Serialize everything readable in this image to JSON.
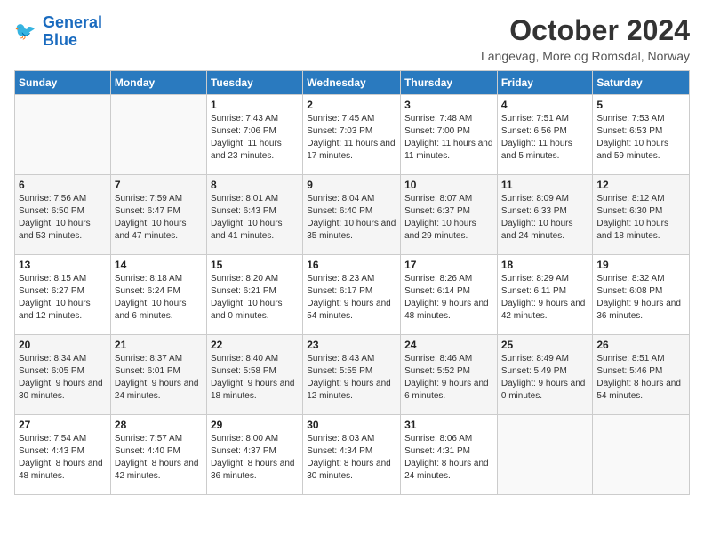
{
  "header": {
    "logo_line1": "General",
    "logo_line2": "Blue",
    "month_title": "October 2024",
    "location": "Langevag, More og Romsdal, Norway"
  },
  "days_of_week": [
    "Sunday",
    "Monday",
    "Tuesday",
    "Wednesday",
    "Thursday",
    "Friday",
    "Saturday"
  ],
  "weeks": [
    [
      {
        "day": "",
        "sunrise": "",
        "sunset": "",
        "daylight": ""
      },
      {
        "day": "",
        "sunrise": "",
        "sunset": "",
        "daylight": ""
      },
      {
        "day": "1",
        "sunrise": "Sunrise: 7:43 AM",
        "sunset": "Sunset: 7:06 PM",
        "daylight": "Daylight: 11 hours and 23 minutes."
      },
      {
        "day": "2",
        "sunrise": "Sunrise: 7:45 AM",
        "sunset": "Sunset: 7:03 PM",
        "daylight": "Daylight: 11 hours and 17 minutes."
      },
      {
        "day": "3",
        "sunrise": "Sunrise: 7:48 AM",
        "sunset": "Sunset: 7:00 PM",
        "daylight": "Daylight: 11 hours and 11 minutes."
      },
      {
        "day": "4",
        "sunrise": "Sunrise: 7:51 AM",
        "sunset": "Sunset: 6:56 PM",
        "daylight": "Daylight: 11 hours and 5 minutes."
      },
      {
        "day": "5",
        "sunrise": "Sunrise: 7:53 AM",
        "sunset": "Sunset: 6:53 PM",
        "daylight": "Daylight: 10 hours and 59 minutes."
      }
    ],
    [
      {
        "day": "6",
        "sunrise": "Sunrise: 7:56 AM",
        "sunset": "Sunset: 6:50 PM",
        "daylight": "Daylight: 10 hours and 53 minutes."
      },
      {
        "day": "7",
        "sunrise": "Sunrise: 7:59 AM",
        "sunset": "Sunset: 6:47 PM",
        "daylight": "Daylight: 10 hours and 47 minutes."
      },
      {
        "day": "8",
        "sunrise": "Sunrise: 8:01 AM",
        "sunset": "Sunset: 6:43 PM",
        "daylight": "Daylight: 10 hours and 41 minutes."
      },
      {
        "day": "9",
        "sunrise": "Sunrise: 8:04 AM",
        "sunset": "Sunset: 6:40 PM",
        "daylight": "Daylight: 10 hours and 35 minutes."
      },
      {
        "day": "10",
        "sunrise": "Sunrise: 8:07 AM",
        "sunset": "Sunset: 6:37 PM",
        "daylight": "Daylight: 10 hours and 29 minutes."
      },
      {
        "day": "11",
        "sunrise": "Sunrise: 8:09 AM",
        "sunset": "Sunset: 6:33 PM",
        "daylight": "Daylight: 10 hours and 24 minutes."
      },
      {
        "day": "12",
        "sunrise": "Sunrise: 8:12 AM",
        "sunset": "Sunset: 6:30 PM",
        "daylight": "Daylight: 10 hours and 18 minutes."
      }
    ],
    [
      {
        "day": "13",
        "sunrise": "Sunrise: 8:15 AM",
        "sunset": "Sunset: 6:27 PM",
        "daylight": "Daylight: 10 hours and 12 minutes."
      },
      {
        "day": "14",
        "sunrise": "Sunrise: 8:18 AM",
        "sunset": "Sunset: 6:24 PM",
        "daylight": "Daylight: 10 hours and 6 minutes."
      },
      {
        "day": "15",
        "sunrise": "Sunrise: 8:20 AM",
        "sunset": "Sunset: 6:21 PM",
        "daylight": "Daylight: 10 hours and 0 minutes."
      },
      {
        "day": "16",
        "sunrise": "Sunrise: 8:23 AM",
        "sunset": "Sunset: 6:17 PM",
        "daylight": "Daylight: 9 hours and 54 minutes."
      },
      {
        "day": "17",
        "sunrise": "Sunrise: 8:26 AM",
        "sunset": "Sunset: 6:14 PM",
        "daylight": "Daylight: 9 hours and 48 minutes."
      },
      {
        "day": "18",
        "sunrise": "Sunrise: 8:29 AM",
        "sunset": "Sunset: 6:11 PM",
        "daylight": "Daylight: 9 hours and 42 minutes."
      },
      {
        "day": "19",
        "sunrise": "Sunrise: 8:32 AM",
        "sunset": "Sunset: 6:08 PM",
        "daylight": "Daylight: 9 hours and 36 minutes."
      }
    ],
    [
      {
        "day": "20",
        "sunrise": "Sunrise: 8:34 AM",
        "sunset": "Sunset: 6:05 PM",
        "daylight": "Daylight: 9 hours and 30 minutes."
      },
      {
        "day": "21",
        "sunrise": "Sunrise: 8:37 AM",
        "sunset": "Sunset: 6:01 PM",
        "daylight": "Daylight: 9 hours and 24 minutes."
      },
      {
        "day": "22",
        "sunrise": "Sunrise: 8:40 AM",
        "sunset": "Sunset: 5:58 PM",
        "daylight": "Daylight: 9 hours and 18 minutes."
      },
      {
        "day": "23",
        "sunrise": "Sunrise: 8:43 AM",
        "sunset": "Sunset: 5:55 PM",
        "daylight": "Daylight: 9 hours and 12 minutes."
      },
      {
        "day": "24",
        "sunrise": "Sunrise: 8:46 AM",
        "sunset": "Sunset: 5:52 PM",
        "daylight": "Daylight: 9 hours and 6 minutes."
      },
      {
        "day": "25",
        "sunrise": "Sunrise: 8:49 AM",
        "sunset": "Sunset: 5:49 PM",
        "daylight": "Daylight: 9 hours and 0 minutes."
      },
      {
        "day": "26",
        "sunrise": "Sunrise: 8:51 AM",
        "sunset": "Sunset: 5:46 PM",
        "daylight": "Daylight: 8 hours and 54 minutes."
      }
    ],
    [
      {
        "day": "27",
        "sunrise": "Sunrise: 7:54 AM",
        "sunset": "Sunset: 4:43 PM",
        "daylight": "Daylight: 8 hours and 48 minutes."
      },
      {
        "day": "28",
        "sunrise": "Sunrise: 7:57 AM",
        "sunset": "Sunset: 4:40 PM",
        "daylight": "Daylight: 8 hours and 42 minutes."
      },
      {
        "day": "29",
        "sunrise": "Sunrise: 8:00 AM",
        "sunset": "Sunset: 4:37 PM",
        "daylight": "Daylight: 8 hours and 36 minutes."
      },
      {
        "day": "30",
        "sunrise": "Sunrise: 8:03 AM",
        "sunset": "Sunset: 4:34 PM",
        "daylight": "Daylight: 8 hours and 30 minutes."
      },
      {
        "day": "31",
        "sunrise": "Sunrise: 8:06 AM",
        "sunset": "Sunset: 4:31 PM",
        "daylight": "Daylight: 8 hours and 24 minutes."
      },
      {
        "day": "",
        "sunrise": "",
        "sunset": "",
        "daylight": ""
      },
      {
        "day": "",
        "sunrise": "",
        "sunset": "",
        "daylight": ""
      }
    ]
  ]
}
